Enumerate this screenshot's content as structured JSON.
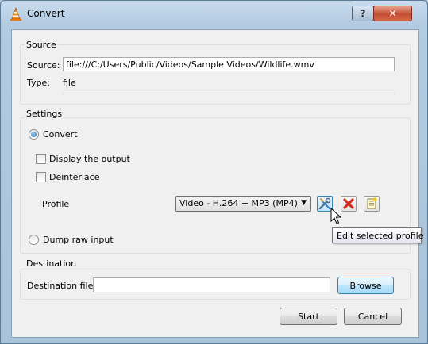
{
  "window": {
    "title": "Convert",
    "help_label": "?",
    "close_label": "✕"
  },
  "source": {
    "legend": "Source",
    "source_label": "Source:",
    "source_value": "file:///C:/Users/Public/Videos/Sample Videos/Wildlife.wmv",
    "type_label": "Type:",
    "type_value": "file"
  },
  "settings": {
    "legend": "Settings",
    "convert_label": "Convert",
    "display_output_label": "Display the output",
    "deinterlace_label": "Deinterlace",
    "profile_label": "Profile",
    "profile_selected": "Video - H.264 + MP3 (MP4)",
    "dump_raw_label": "Dump raw input",
    "tooltip": "Edit selected profile"
  },
  "destination": {
    "legend": "Destination",
    "file_label": "Destination file:",
    "file_value": "",
    "browse_label": "Browse"
  },
  "footer": {
    "start_label": "Start",
    "cancel_label": "Cancel"
  },
  "colors": {
    "accent": "#3c7fb1",
    "delete_red": "#d42b1e"
  },
  "icons": [
    "vlc-cone-icon",
    "wrench-screwdriver-icon",
    "delete-icon",
    "new-profile-icon",
    "mouse-cursor-icon"
  ]
}
